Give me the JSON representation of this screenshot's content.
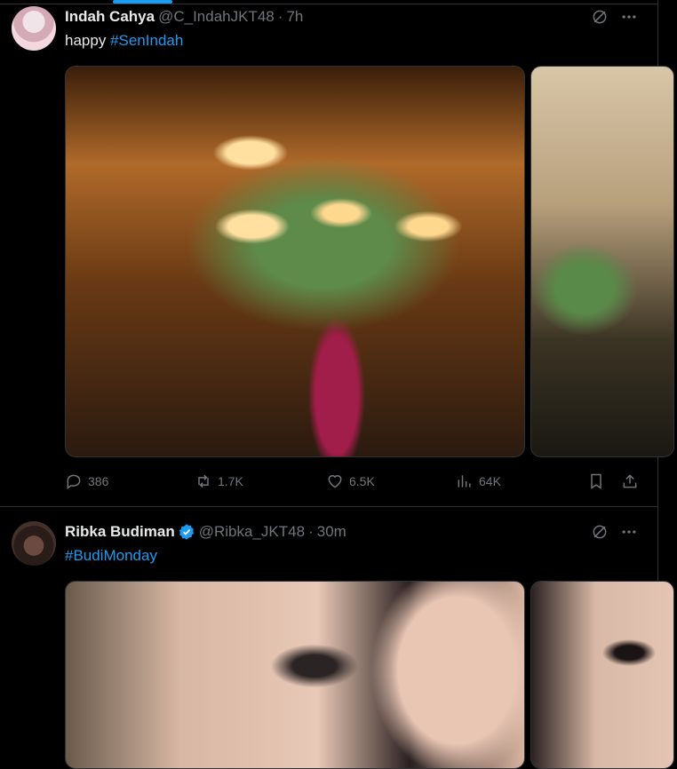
{
  "post1": {
    "name": "Indah Cahya",
    "handle": "@C_IndahJKT48",
    "time": "7h",
    "text_prefix": "happy",
    "hashtag": "#SenIndah",
    "stats": {
      "replies": "386",
      "reposts": "1.7K",
      "likes": "6.5K",
      "views": "64K"
    }
  },
  "post2": {
    "name": "Ribka Budiman",
    "handle": "@Ribka_JKT48",
    "time": "30m",
    "hashtag": "#BudiMonday"
  },
  "separator": "·",
  "colors": {
    "background": "#000000",
    "text": "#e7e9ea",
    "muted": "#71767b",
    "accent": "#1d9bf0",
    "border": "#2f3336"
  }
}
